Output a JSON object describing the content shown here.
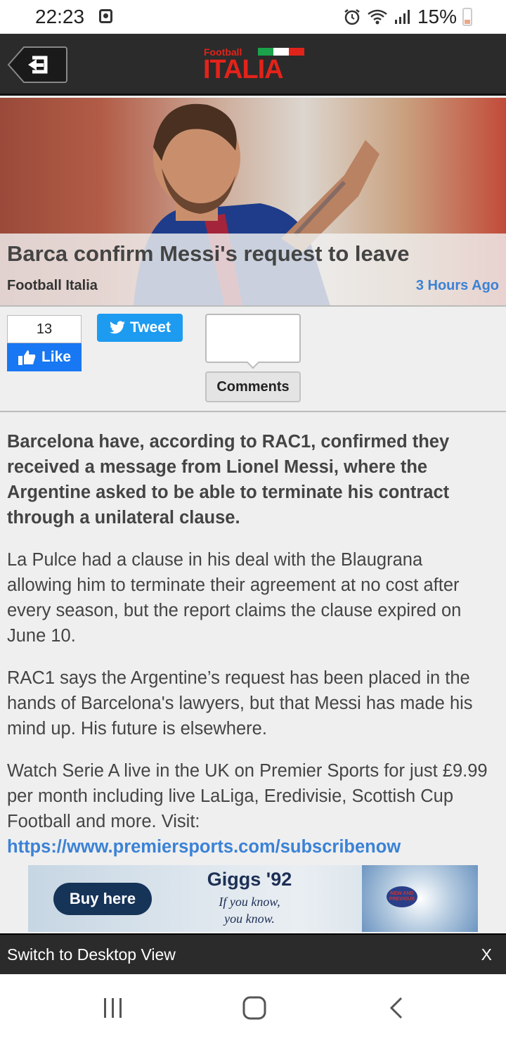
{
  "status_bar": {
    "time": "22:23",
    "battery": "15%"
  },
  "header": {
    "logo_small": "Football",
    "logo_big": "ITALIA",
    "flag_colors": [
      "#1aa34a",
      "#ffffff",
      "#e2231a"
    ]
  },
  "article": {
    "title": "Barca confirm Messi's request to leave",
    "source": "Football Italia",
    "time_ago": "3 Hours Ago",
    "paragraphs": {
      "lead": "Barcelona have, according to RAC1, confirmed they received a message from Lionel Messi, where the Argentine asked to be able to terminate his contract through a unilateral clause.",
      "p2": "La Pulce had a clause in his deal with the Blaugrana allowing him to terminate their agreement at no cost after every season, but the report claims the clause expired on June 10.",
      "p3": "RAC1 says the Argentine’s request has been placed in the hands of Barcelona's lawyers, but that Messi has made his mind up. His future is elsewhere.",
      "p4": "Watch Serie A live in the UK on Premier Sports for just £9.99 per month including live LaLiga, Eredivisie, Scottish Cup Football and more. Visit:",
      "link": "https://www.premiersports.com/subscribenow"
    }
  },
  "social": {
    "like_count": "13",
    "like_label": "Like",
    "tweet_label": "Tweet",
    "comments_label": "Comments"
  },
  "ad": {
    "button": "Buy here",
    "headline": "Giggs '92",
    "tagline_1": "If you know,",
    "tagline_2": "you know.",
    "badge": "NEW AND PREVIOUS"
  },
  "desktop_bar": {
    "label": "Switch to Desktop View",
    "close": "X"
  },
  "colors": {
    "accent": "#3b82d6",
    "header_bg": "#2b2b2b",
    "facebook": "#1877f2",
    "twitter": "#1d9bf0"
  }
}
